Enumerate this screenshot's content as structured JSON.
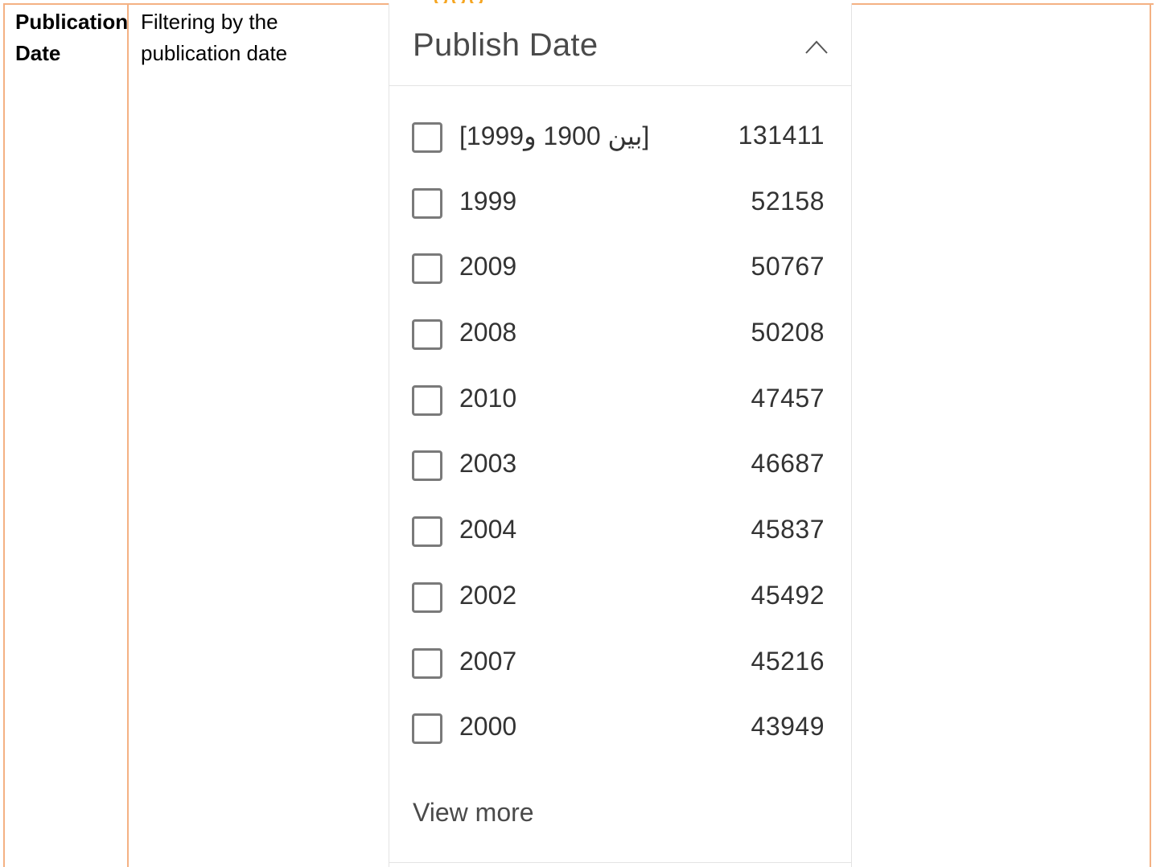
{
  "table": {
    "term": "Publication Date",
    "description": "Filtering by the publication date"
  },
  "panel": {
    "title": "Publish Date",
    "expanded": true,
    "items": [
      {
        "label": "[بين 1900 و1999]",
        "count": "131411",
        "checked": false
      },
      {
        "label": "1999",
        "count": "52158",
        "checked": false
      },
      {
        "label": "2009",
        "count": "50767",
        "checked": false
      },
      {
        "label": "2008",
        "count": "50208",
        "checked": false
      },
      {
        "label": "2010",
        "count": "47457",
        "checked": false
      },
      {
        "label": "2003",
        "count": "46687",
        "checked": false
      },
      {
        "label": "2004",
        "count": "45837",
        "checked": false
      },
      {
        "label": "2002",
        "count": "45492",
        "checked": false
      },
      {
        "label": "2007",
        "count": "45216",
        "checked": false
      },
      {
        "label": "2000",
        "count": "43949",
        "checked": false
      }
    ],
    "view_more_label": "View more"
  },
  "colors": {
    "table_border": "#f4b183",
    "accent_dots": "#f5a623",
    "text": "#333333",
    "checkbox_border": "#7a7a7a"
  }
}
